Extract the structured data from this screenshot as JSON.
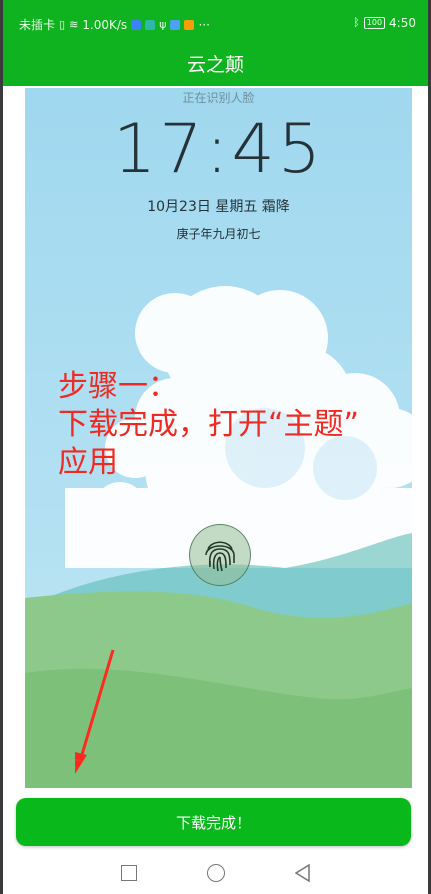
{
  "status_bar": {
    "left_text": "未插卡",
    "speed": "1.00K/s",
    "more": "···",
    "battery": "100",
    "time": "4:50"
  },
  "app_bar": {
    "title": "云之颠"
  },
  "lockscreen": {
    "recognizing": "正在识别人脸",
    "time": "17:45",
    "date": "10月23日 星期五  霜降",
    "lunar": "庚子年九月初七"
  },
  "annotation": {
    "text": "步骤一：\n下载完成，打开“主题”\n应用",
    "color": "#f02a22"
  },
  "download_button": {
    "label": "下载完成！"
  },
  "icons": [
    "wifi-icon",
    "bluetooth-icon",
    "fingerprint-icon",
    "recents-square-icon",
    "home-circle-icon",
    "back-triangle-icon",
    "arrow-icon"
  ],
  "colors": {
    "accent": "#0eb31f",
    "button": "#09b81a",
    "annotation": "#f02a22"
  }
}
